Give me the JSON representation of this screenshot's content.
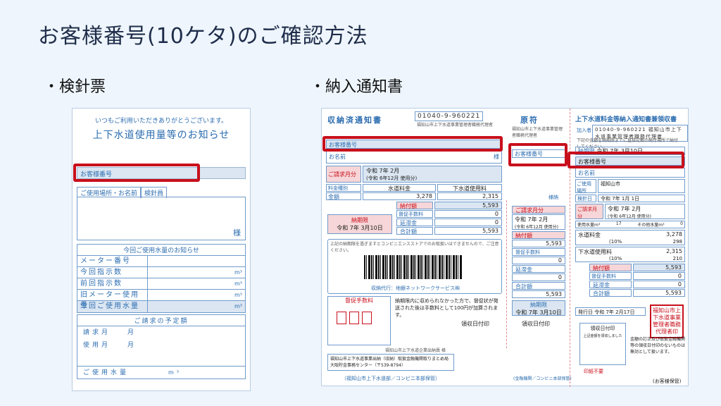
{
  "title": "お客様番号(10ケタ)のご確認方法",
  "meter_slip": {
    "bullet_label": "・検針票",
    "thanks": "いつもご利用いただきありがとうございます。",
    "heading": "上下水道使用量等のお知らせ",
    "customer_number_label": "お客様番号",
    "tab_address": "ご使用場所・お名前",
    "tab_inspector": "検針員",
    "sama": "様",
    "usage_header": "今回ご使用水量のお知らせ",
    "usage_rows": [
      {
        "label": "メーター番号",
        "unit": ""
      },
      {
        "label": "今回指示数",
        "unit": "m³"
      },
      {
        "label": "前回指示数",
        "unit": "m³"
      },
      {
        "label": "旧メーター使用量",
        "unit": "m³"
      },
      {
        "label": "今回ご使用水量",
        "unit": "m³"
      }
    ],
    "plan_header": "ご請求の予定額",
    "plan_rows": [
      {
        "label": "請求月",
        "unit": "月"
      },
      {
        "label": "使用月",
        "unit": "月"
      },
      {
        "label": "ご使用水量",
        "unit": "m³"
      }
    ]
  },
  "notice": {
    "bullet_label": "・納入通知書",
    "receipt_title": "収納済通知書",
    "account_no": "01040-9-960221",
    "account_no2": "01040-9-960221",
    "account_name": "福知山市上下水道事業管理者職務代理者",
    "customer_number_label": "お客様番号",
    "name_label": "お名前",
    "sama": "様",
    "billing_month_label": "ご請求月分",
    "billing_month": "令和 7年 2月",
    "usage_period": "(令和 6年12月 使用分)",
    "fee_type_label": "料金種別",
    "water_fee_label": "水道料金",
    "sewer_fee_label": "下水道使用料",
    "amount_label": "金額",
    "water_amount": "3,278",
    "sewer_amount": "2,315",
    "yen": "円",
    "payment_amount_label": "納付額",
    "payment_amount": "5,593",
    "surcharge_label": "督促手数料",
    "surcharge": "0",
    "late_fee_label": "延滞金",
    "late_fee": "0",
    "total_label": "合計額",
    "total": "5,593",
    "due_label": "納期限",
    "due_date": "令和 7年 3月10日",
    "store_note": "上記の納期限を過ぎますとコンビニエンスストアでのお取扱いはできませんので、ご注意ください。",
    "agent": "収納代行：地銀ネットワークサービス㈱",
    "overdue_fee_label": "督促手数料",
    "overdue_note": "納期限内に収められなかった方で、督促状が発送された後は手数料として100円が加算されます。",
    "receipt_date_label": "領収日付印",
    "issuer": "福知山市上下水道企業出納員 様",
    "bank_note": "福知山市上下水道事業出納（収納）取扱金融機関取りまとめ局 大阪貯金事務センター（〒539-8794）",
    "keep_note": "（福知山市上下水道部／コンビニ本部保管）",
    "original_title": "原符",
    "original_name": "福知山市上下水道事業管理者職務代理者",
    "payment_no_label": "様納",
    "keep_note2": "(金融機関／コンビニ本部保管)",
    "receipt2_title": "上下水道料金等納入通知書兼領収書",
    "subscriber_label": "加入者",
    "receipt2_note": "下記の金額を納期限までに直接記載の納付場所で納付してください。",
    "use_place_label": "ご使用場所",
    "city": "福知山市",
    "meter_date_label": "検針日",
    "meter_date": "令和 7年 1月 1日",
    "use_volume_label": "使用水量m³",
    "use_volume": "17",
    "other_usage_label": "その他水量m³",
    "other_usage": "0",
    "tax_10": "(10%",
    "water_tax": "298",
    "sewer_tax": "210",
    "issue_date_label": "発行日",
    "issue_date": "令和 7年 2月17日",
    "receipt_note2": "上記金額を領収しました",
    "stamp_text": "福知山市上下水道事業管理者職務代理者印",
    "fix_note": "金額の訂正及び取扱金融機関等の領収日付印のないものは無効として扱います。",
    "stamp_duty": "印紙不要",
    "footer": "(お客様保管)"
  },
  "colors": {
    "highlight": "#c8101c",
    "form_blue": "#2c6db0",
    "background": "#eef5fc"
  }
}
